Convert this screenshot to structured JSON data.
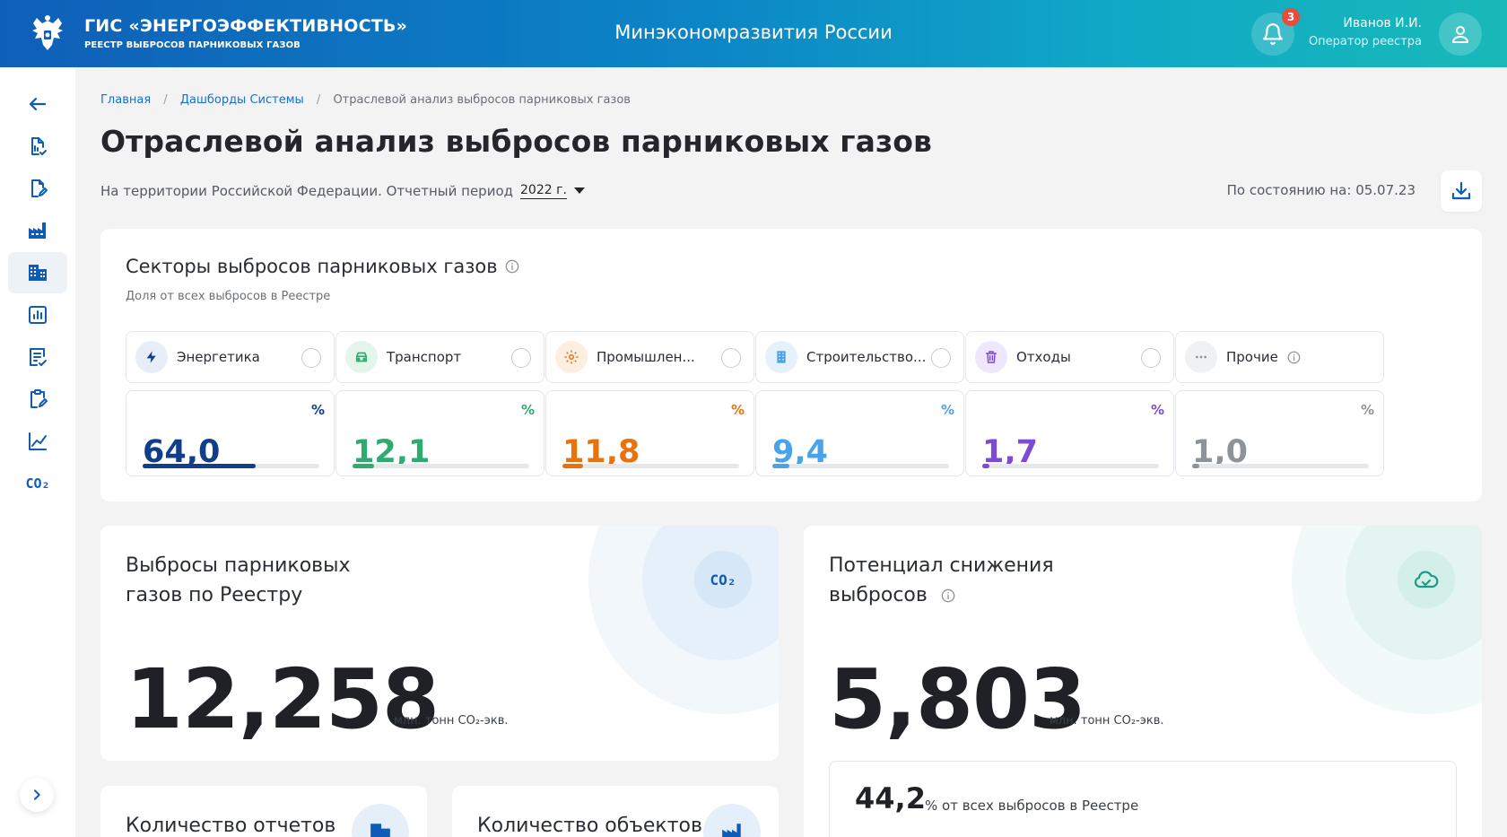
{
  "header": {
    "brand_title": "ГИС «ЭНЕРГОЭФФЕКТИВНОСТЬ»",
    "brand_subtitle": "РЕЕСТР ВЫБРОСОВ ПАРНИКОВЫХ ГАЗОВ",
    "ministry": "Минэкономразвития России",
    "notifications_count": "3",
    "user_name": "Иванов И.И.",
    "user_role": "Оператор реестра"
  },
  "sidebar": {
    "items": [
      {
        "icon": "arrow-left-icon"
      },
      {
        "icon": "report-check-icon"
      },
      {
        "icon": "document-edit-icon"
      },
      {
        "icon": "factory-icon"
      },
      {
        "icon": "buildings-icon",
        "active": true
      },
      {
        "icon": "bar-chart-icon"
      },
      {
        "icon": "list-check-icon"
      },
      {
        "icon": "clipboard-edit-icon"
      },
      {
        "icon": "line-chart-icon"
      },
      {
        "icon": "co2-icon",
        "label": "CO₂"
      }
    ]
  },
  "breadcrumb": {
    "items": [
      "Главная",
      "Дашборды Системы",
      "Отраслевой анализ выбросов парниковых газов"
    ],
    "separator": "/"
  },
  "page": {
    "title": "Отраслевой анализ выбросов парниковых газов",
    "filter_text": "На территории Российской Федерации. Отчетный период",
    "period": "2022 г.",
    "status": "По состоянию на: 05.07.23"
  },
  "sectors": {
    "title": "Секторы выбросов парниковых газов",
    "subtitle": "Доля от всех выбросов в Реестре",
    "pct_symbol": "%",
    "items": [
      {
        "label": "Энергетика",
        "value": "64,0",
        "share": 64.0,
        "color": "#0f3e8c",
        "icon_bg": "#e8eef8",
        "icon": "lightning-icon"
      },
      {
        "label": "Транспорт",
        "value": "12,1",
        "share": 12.1,
        "color": "#2eab6f",
        "icon_bg": "#e4f5ec",
        "icon": "car-icon"
      },
      {
        "label": "Промышлен...",
        "value": "11,8",
        "share": 11.8,
        "color": "#e8720c",
        "icon_bg": "#fdeee2",
        "icon": "gear-icon"
      },
      {
        "label": "Строительство...",
        "value": "9,4",
        "share": 9.4,
        "color": "#4aa3e8",
        "icon_bg": "#e6f1fb",
        "icon": "building-icon"
      },
      {
        "label": "Отходы",
        "value": "1,7",
        "share": 1.7,
        "color": "#7d4ad6",
        "icon_bg": "#efe7fb",
        "icon": "trash-icon"
      },
      {
        "label": "Прочие",
        "value": "1,0",
        "share": 1.0,
        "color": "#8e9299",
        "icon_bg": "#f0f1f3",
        "icon": "dots-icon"
      }
    ]
  },
  "emissions": {
    "title": "Выбросы парниковых газов по Реестру",
    "value": "12,258",
    "unit": "млн. тонн CO₂-экв.",
    "icon_label": "CO₂"
  },
  "reduction": {
    "title": "Потенциал снижения выбросов",
    "value": "5,803",
    "unit": "млн. тонн CO₂-экв.",
    "share_value": "44,2",
    "share_text": "% от всех выбросов в Реестре"
  },
  "reports": {
    "title": "Количество отчетов"
  },
  "objects": {
    "title": "Количество объектов"
  }
}
